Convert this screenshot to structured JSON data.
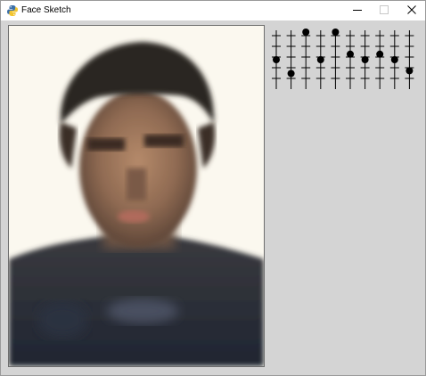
{
  "window": {
    "title": "Face Sketch",
    "icon": "python-icon"
  },
  "controls": {
    "minimize_icon": "minimize-icon",
    "maximize_icon": "maximize-icon",
    "close_icon": "close-icon"
  },
  "image": {
    "description_icon": "generated-face-image"
  },
  "sliders": {
    "count": 10,
    "knob_color": "#000000",
    "values": [
      0.5,
      0.25,
      1.0,
      0.5,
      1.0,
      0.6,
      0.5,
      0.6,
      0.5,
      0.3
    ]
  }
}
